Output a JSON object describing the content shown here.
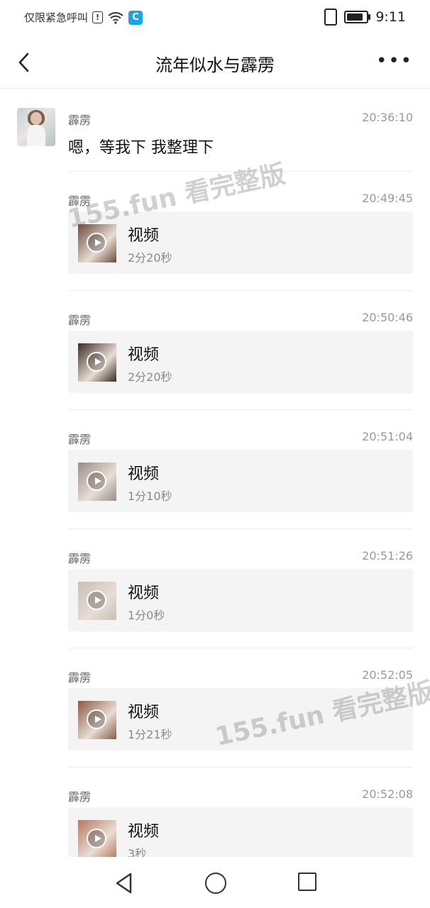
{
  "status_bar": {
    "carrier_text": "仅限紧急呼叫",
    "time": "9:11",
    "battery_level": 0.85
  },
  "header": {
    "title": "流年似水与霹雳"
  },
  "messages": [
    {
      "sender": "霹雳",
      "time": "20:36:10",
      "text": "嗯，等我下 我整理下"
    },
    {
      "sender": "霹雳",
      "time": "20:49:45",
      "card_title": "视频",
      "duration": "2分20秒",
      "thumb": "#6b4a3a"
    },
    {
      "sender": "霹雳",
      "time": "20:50:46",
      "card_title": "视频",
      "duration": "2分20秒",
      "thumb": "#3a2a22"
    },
    {
      "sender": "霹雳",
      "time": "20:51:04",
      "card_title": "视频",
      "duration": "1分10秒",
      "thumb": "#9a8f88"
    },
    {
      "sender": "霹雳",
      "time": "20:51:26",
      "card_title": "视频",
      "duration": "1分0秒",
      "thumb": "#c9bfb6"
    },
    {
      "sender": "霹雳",
      "time": "20:52:05",
      "card_title": "视频",
      "duration": "1分21秒",
      "thumb": "#8c5a44"
    },
    {
      "sender": "霹雳",
      "time": "20:52:08",
      "card_title": "视频",
      "duration": "3秒",
      "thumb": "#b47a60"
    }
  ],
  "watermark": "155.fun 看完整版",
  "icons": {
    "back": "chevron-left-icon",
    "more": "more-horizontal-icon",
    "play": "play-icon",
    "nav_back": "triangle-back-icon",
    "nav_home": "circle-home-icon",
    "nav_recent": "square-recent-icon"
  }
}
